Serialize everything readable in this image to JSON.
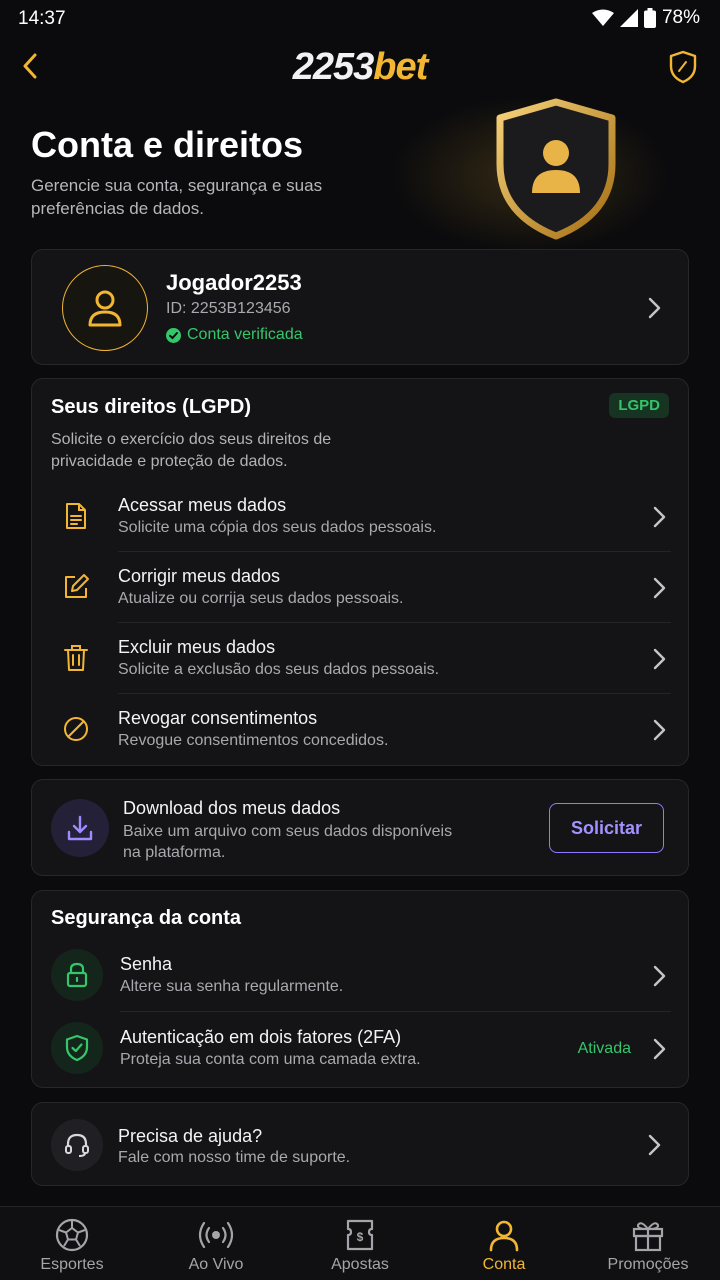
{
  "status_bar": {
    "time": "14:37",
    "battery": "78%"
  },
  "header": {
    "logo_number": "2253",
    "logo_suffix": "bet"
  },
  "page": {
    "title": "Conta e direitos",
    "subtitle": "Gerencie sua conta, segurança e suas preferências de dados."
  },
  "profile": {
    "username": "Jogador2253",
    "id": "ID: 2253B123456",
    "verified_label": "Conta verificada"
  },
  "rights": {
    "title": "Seus direitos (LGPD)",
    "badge": "LGPD",
    "description": "Solicite o exercício dos seus direitos de privacidade e proteção de dados.",
    "items": [
      {
        "title": "Acessar meus dados",
        "subtitle": "Solicite uma cópia dos seus dados pessoais.",
        "icon": "document-icon"
      },
      {
        "title": "Corrigir meus dados",
        "subtitle": "Atualize ou corrija seus dados pessoais.",
        "icon": "edit-icon"
      },
      {
        "title": "Excluir meus dados",
        "subtitle": "Solicite a exclusão dos seus dados pessoais.",
        "icon": "trash-icon"
      },
      {
        "title": "Revogar consentimentos",
        "subtitle": "Revogue consentimentos concedidos.",
        "icon": "block-icon"
      }
    ]
  },
  "download": {
    "title": "Download dos meus dados",
    "subtitle": "Baixe um arquivo com seus dados disponíveis na plataforma.",
    "button": "Solicitar"
  },
  "security": {
    "title": "Segurança da conta",
    "items": [
      {
        "title": "Senha",
        "subtitle": "Altere sua senha regularmente.",
        "status": ""
      },
      {
        "title": "Autenticação em dois fatores (2FA)",
        "subtitle": "Proteja sua conta com uma camada extra.",
        "status": "Ativada"
      }
    ]
  },
  "help": {
    "title": "Precisa de ajuda?",
    "subtitle": "Fale com nosso time de suporte."
  },
  "nav": {
    "items": [
      {
        "label": "Esportes",
        "icon": "soccer-ball-icon"
      },
      {
        "label": "Ao Vivo",
        "icon": "live-icon"
      },
      {
        "label": "Apostas",
        "icon": "ticket-icon"
      },
      {
        "label": "Conta",
        "icon": "user-icon"
      },
      {
        "label": "Promoções",
        "icon": "gift-icon"
      }
    ],
    "active_index": 3
  },
  "colors": {
    "accent": "#f2b632",
    "success": "#35c66b",
    "primary": "#8f7bff",
    "background": "#0b0b0d"
  }
}
